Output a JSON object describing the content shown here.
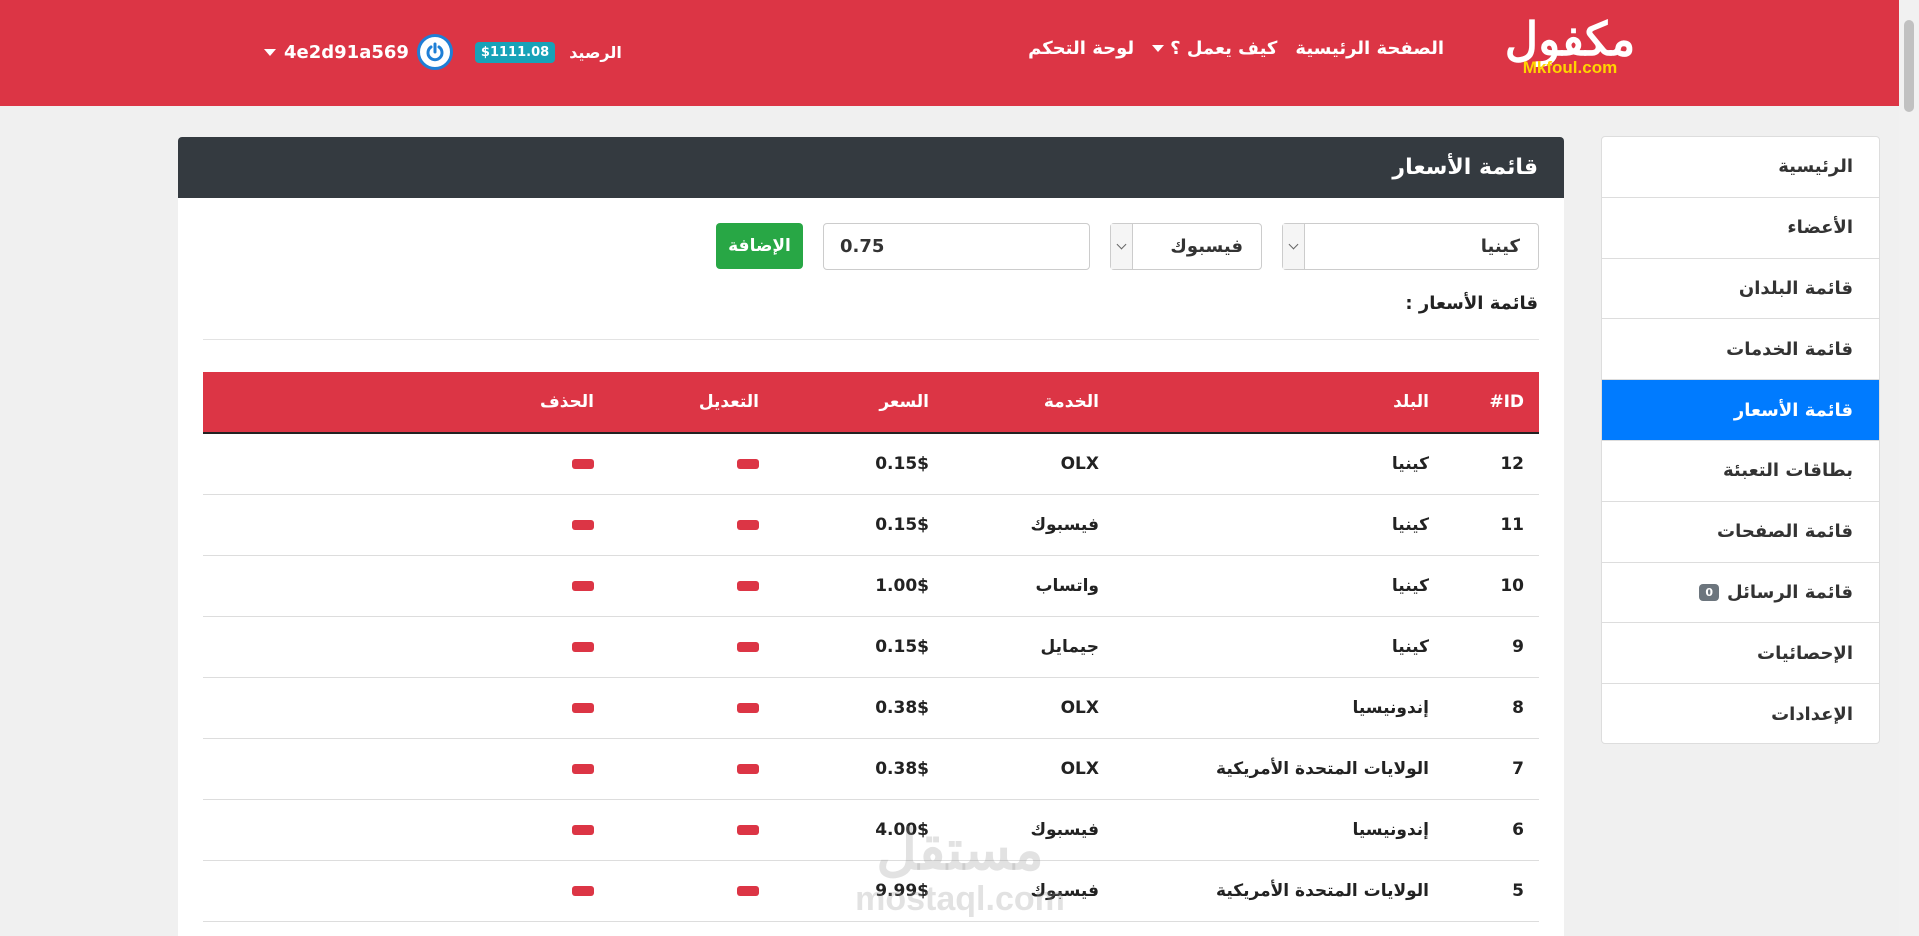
{
  "header": {
    "logo_ar": "مكفول",
    "logo_en": "Mkfoul.com",
    "nav": {
      "home": "الصفحة الرئيسية",
      "how_it_works": "كيف يعمل ؟",
      "dashboard": "لوحة التحكم"
    },
    "account": {
      "username": "4e2d91a569",
      "balance_label": "الرصيد",
      "balance_value": "$1111.08"
    }
  },
  "sidebar": {
    "items": [
      {
        "label": "الرئيسية"
      },
      {
        "label": "الأعضاء"
      },
      {
        "label": "قائمة البلدان"
      },
      {
        "label": "قائمة الخدمات"
      },
      {
        "label": "قائمة الأسعار",
        "active": true
      },
      {
        "label": "بطاقات التعبئة"
      },
      {
        "label": "قائمة الصفحات"
      },
      {
        "label": "قائمة الرسائل",
        "badge": "0"
      },
      {
        "label": "الإحصائيات"
      },
      {
        "label": "الإعدادات"
      }
    ]
  },
  "panel": {
    "title": "قائمة الأسعار",
    "form": {
      "country_value": "كينيا",
      "service_value": "فيسبوك",
      "price_value": "0.75",
      "add_label": "الإضافة"
    },
    "list_label": "قائمة الأسعار :",
    "table": {
      "headers": {
        "id": "ID#",
        "country": "البلد",
        "service": "الخدمة",
        "price": "السعر",
        "edit": "التعديل",
        "delete": "الحذف"
      },
      "rows": [
        {
          "id": "12",
          "country": "كينيا",
          "service": "OLX",
          "price": "0.15$"
        },
        {
          "id": "11",
          "country": "كينيا",
          "service": "فيسبوك",
          "price": "0.15$"
        },
        {
          "id": "10",
          "country": "كينيا",
          "service": "واتساب",
          "price": "1.00$"
        },
        {
          "id": "9",
          "country": "كينيا",
          "service": "جيمايل",
          "price": "0.15$"
        },
        {
          "id": "8",
          "country": "إندونيسيا",
          "service": "OLX",
          "price": "0.38$"
        },
        {
          "id": "7",
          "country": "الولايات المتحدة الأمريكية",
          "service": "OLX",
          "price": "0.38$"
        },
        {
          "id": "6",
          "country": "إندونيسيا",
          "service": "فيسبوك",
          "price": "4.00$"
        },
        {
          "id": "5",
          "country": "الولايات المتحدة الأمريكية",
          "service": "فيسبوك",
          "price": "9.99$"
        }
      ]
    }
  },
  "watermark": {
    "ar": "مستقل",
    "en": "mostaql.com"
  },
  "colors": {
    "header": "#dc3545",
    "active": "#007bff",
    "add_button": "#28a745",
    "panel_head": "#343a40"
  }
}
